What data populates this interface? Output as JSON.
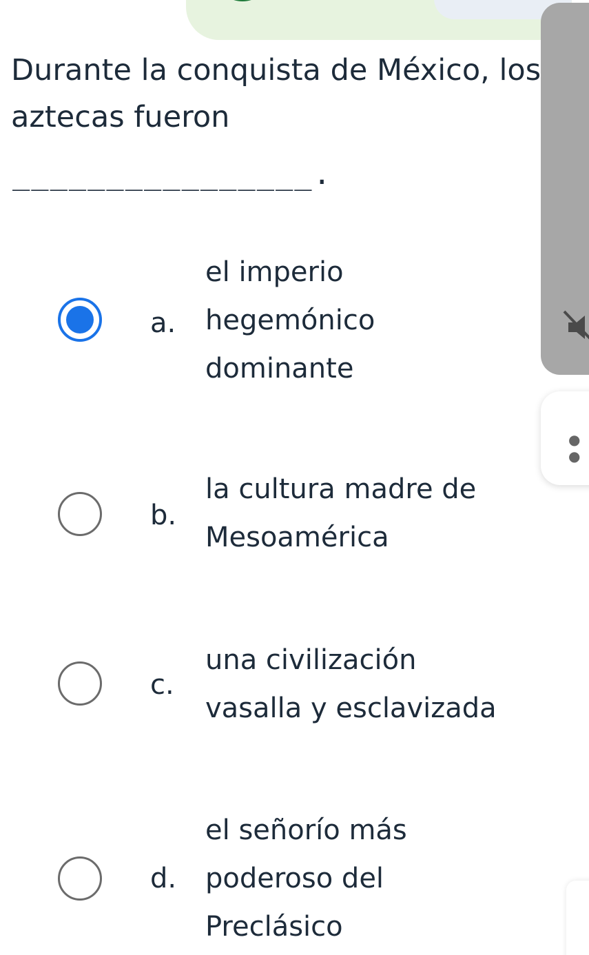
{
  "question": {
    "text": "Durante la conquista de México, los aztecas fueron",
    "blank": "________________."
  },
  "options": [
    {
      "letter": "a.",
      "lines": [
        "el imperio",
        "hegemónico",
        "dominante"
      ],
      "selected": true
    },
    {
      "letter": "b.",
      "lines": [
        "la cultura madre de",
        "Mesoamérica"
      ],
      "selected": false
    },
    {
      "letter": "c.",
      "lines": [
        "una civilización",
        "vasalla y esclavizada"
      ],
      "selected": false
    },
    {
      "letter": "d.",
      "lines": [
        "el señorío más",
        "poderoso del",
        "Preclásico"
      ],
      "selected": false
    }
  ],
  "colors": {
    "accent": "#1a73e8",
    "text": "#1d2b3a",
    "banner": "#e7f3df",
    "side_panel": "#a7a7a7"
  },
  "icons": {
    "side_panel_icon": "muted-volume-icon",
    "side_card_icon": "more-dots-icon"
  }
}
